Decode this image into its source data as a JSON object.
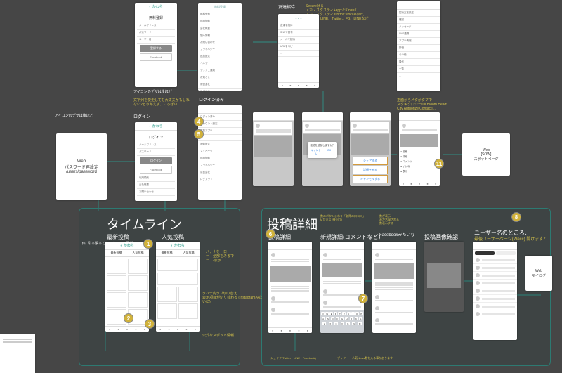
{
  "sections": {
    "timeline_title": "タイムライン",
    "post_detail_title": "投稿詳細",
    "timeline_sub1": "最新投稿",
    "timeline_sub2": "人気投稿",
    "post_sub1": "投稿詳細",
    "post_sub2": "新規詳細(コメントなど)",
    "post_sub3": "投稿画像確認",
    "post_sub4_prefix": "ユーザー名のところ、",
    "post_sub4_line2": "最後ユーザーページ(Wecc) 開けます？"
  },
  "annotations": {
    "icon_design1": "アイコンのデザは後ほど",
    "icon_design2": "アイコンのデザは後ほど",
    "login_note": "文字列を変更しても大丈夫かもしれ\nない?とりあえず、いっぱい",
    "login_header": "ログイン",
    "logged_in": "ログイン済み",
    "friend_invite": "友達招待",
    "invite_note": "Secureける\n・カノスタスティ+app://:Kinatu/...\n・カノスタスティ=\"https://locale/ja/x,\n・LINE、LINE、Twitter、FB、LINEなど",
    "action_note": "正面からメタがタブで\nスタキクロジー\\UI Bloom Head\\\nCity Authorize|Contact|...",
    "web_reset": "Web\nパスワード再設定\n/users/password",
    "web_spot": "Web\n[SOW]\nスポットページ",
    "pull_refresh": "下に引っ張ってタイムライン更新",
    "popular_note": "・バナナを一日\n・ー・全部をみるで\n・ー・-表示",
    "popular_note2": "クバナ内タブ切り替え\n表示項目が切り替わる (Instagramみたいに)",
    "official_note": "公式なスポット情報",
    "post_small1": "数のボタンまわり「取得の口コミ」\nMたいな (後回り)",
    "post_small2": "数が表示\n表か名録される\n数表示する",
    "facebook_like": "Facebookみたいな",
    "web_mylog": "Web\nマイログ",
    "bottom_note": "シェイク(Twitter・LINE・Facebook)",
    "bottom_note2": "ブックーー 人気News数を入る事があります"
  },
  "screens": {
    "signup": {
      "title": "無料登録",
      "email": "メールアドレス",
      "pass": "パスワード",
      "name": "ユーザー名",
      "btn": "登録する",
      "fb": "Facebook"
    },
    "login": {
      "title": "ログイン",
      "email": "メールアドレス",
      "pass": "パスワード",
      "btn": "ログイン",
      "fb": "Facebook"
    },
    "settings_rows": [
      "無料登録",
      "利用規約",
      "会社概要",
      "個人情報",
      "お問い合わせ",
      "プライバシー",
      "連携設定",
      "ヘルプ",
      "プッシュ通知",
      "お知らせ",
      "運営会社",
      "ログアウト"
    ],
    "logged_rows": [
      "ログイン済み",
      "アカウント設定",
      "連携アプリ",
      "…",
      "通知設定",
      "マイページ",
      "利用規約",
      "プライバシー",
      "運営会社",
      "ログアウト"
    ],
    "invite_rows": [
      "友達を招待",
      "SNSで共有",
      "メールで招待",
      "URLをコピー",
      "…"
    ],
    "action_rows": [
      "招待文言設定",
      "確認",
      "メッセージ",
      "SNS連携",
      "アプリ情報",
      "評価",
      "その他",
      "操作",
      "一覧",
      "…"
    ],
    "modal": {
      "text": "投稿を追加しますか？",
      "cancel": "キャンセル",
      "ok": "OK"
    },
    "sheet": {
      "opt1": "シェアする",
      "opt2": "詳細をみる",
      "opt3": "キャンセルする"
    },
    "bullets": [
      "投稿",
      "詳細",
      "コメント",
      "いいね",
      "表示"
    ]
  },
  "badges": {
    "b1": "1",
    "b2": "2",
    "b3": "3",
    "b4": "4",
    "b5": "5",
    "b6": "6",
    "b7": "7",
    "b8": "8",
    "b11": "11"
  }
}
